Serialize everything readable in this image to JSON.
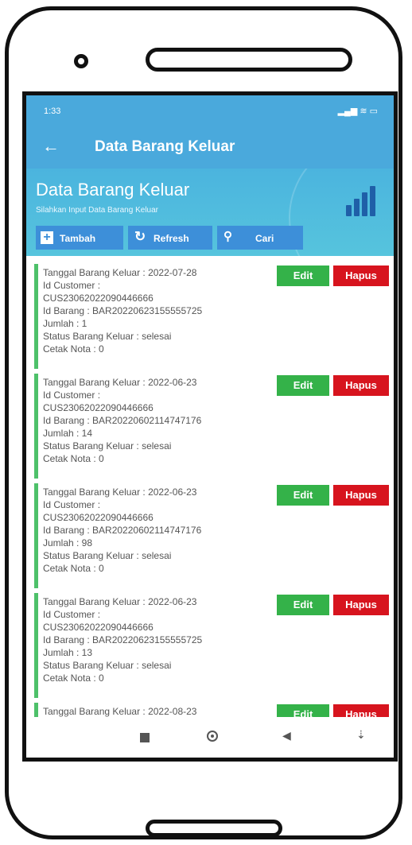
{
  "status_bar": {
    "time": "1:33",
    "right_icons": "▂▄▆ ≋ ▭"
  },
  "app_bar": {
    "back_glyph": "←",
    "title": "Data Barang Keluar"
  },
  "header": {
    "title": "Data Barang Keluar",
    "subtitle": "Silahkan Input Data Barang Keluar",
    "buttons": {
      "add": "Tambah",
      "refresh": "Refresh",
      "search": "Cari"
    }
  },
  "actions": {
    "edit": "Edit",
    "delete": "Hapus"
  },
  "records": [
    {
      "tanggal": "Tanggal Barang Keluar : 2022-07-28",
      "id_customer_label": "Id Customer :",
      "id_customer": "CUS23062022090446666",
      "id_barang": "Id Barang : BAR20220623155555725",
      "jumlah": "Jumlah : 1",
      "status": "Status Barang Keluar : selesai",
      "cetak": "Cetak Nota : 0"
    },
    {
      "tanggal": "Tanggal Barang Keluar : 2022-06-23",
      "id_customer_label": "Id Customer :",
      "id_customer": "CUS23062022090446666",
      "id_barang": "Id Barang : BAR20220602114747176",
      "jumlah": "Jumlah : 14",
      "status": "Status Barang Keluar : selesai",
      "cetak": "Cetak Nota : 0"
    },
    {
      "tanggal": "Tanggal Barang Keluar : 2022-06-23",
      "id_customer_label": "Id Customer :",
      "id_customer": "CUS23062022090446666",
      "id_barang": "Id Barang : BAR20220602114747176",
      "jumlah": "Jumlah : 98",
      "status": "Status Barang Keluar : selesai",
      "cetak": "Cetak Nota : 0"
    },
    {
      "tanggal": "Tanggal Barang Keluar : 2022-06-23",
      "id_customer_label": "Id Customer :",
      "id_customer": "CUS23062022090446666",
      "id_barang": "Id Barang : BAR20220623155555725",
      "jumlah": "Jumlah : 13",
      "status": "Status Barang Keluar : selesai",
      "cetak": "Cetak Nota : 0"
    }
  ],
  "partial_record": {
    "tanggal": "Tanggal Barang Keluar : 2022-08-23"
  },
  "colors": {
    "primary": "#4aa9dc",
    "button": "#3d8fd9",
    "edit": "#34b249",
    "delete": "#d7141e",
    "accent_bar": "#4ec16a"
  }
}
